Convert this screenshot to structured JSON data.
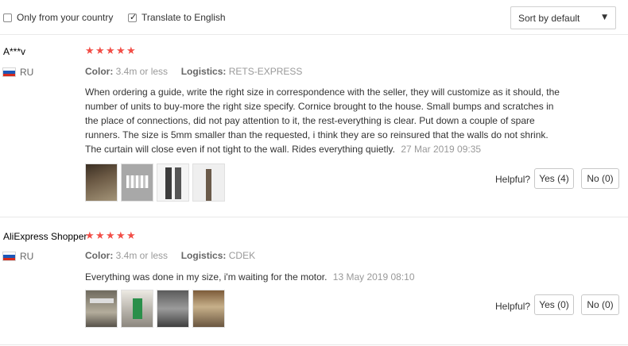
{
  "filters": {
    "only_country_label": "Only from your country",
    "only_country_checked": false,
    "translate_label": "Translate to English",
    "translate_checked": true,
    "sort_label": "Sort by default"
  },
  "reviews": [
    {
      "author": "A***v",
      "country": "RU",
      "rating": 5,
      "color_key": "Color:",
      "color_value": "3.4m or less",
      "logistics_key": "Logistics:",
      "logistics_value": "RETS-EXPRESS",
      "text": "When ordering a guide, write the right size in correspondence with the seller, they will customize as it should, the number of units to buy-more the right size specify. Cornice brought to the house. Small bumps and scratches in the place of connections, did not pay attention to it, the rest-everything is clear. Put down a couple of spare runners. The size is 5mm smaller than the requested, i think they are so reinsured that the walls do not shrink. The curtain will close even if not tight to the wall. Rides everything quietly.",
      "date": "27 Mar 2019 09:35",
      "photo_count": 4,
      "helpful_label": "Helpful?",
      "yes_label": "Yes (4)",
      "no_label": "No (0)"
    },
    {
      "author": "AliExpress Shopper",
      "country": "RU",
      "rating": 5,
      "color_key": "Color:",
      "color_value": "3.4m or less",
      "logistics_key": "Logistics:",
      "logistics_value": "CDEK",
      "text": "Everything was done in my size, i'm waiting for the motor.",
      "date": "13 May 2019 08:10",
      "photo_count": 4,
      "helpful_label": "Helpful?",
      "yes_label": "Yes (0)",
      "no_label": "No (0)"
    }
  ],
  "colors": {
    "star": "#f24e47",
    "muted": "#999999"
  }
}
